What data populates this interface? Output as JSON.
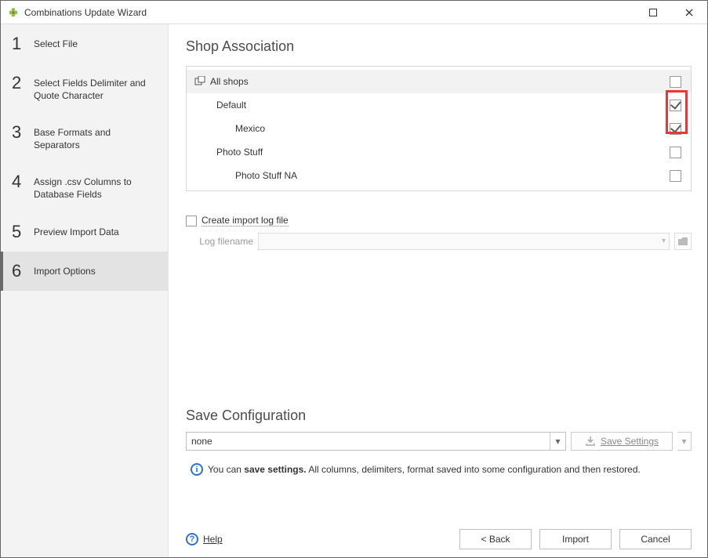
{
  "window": {
    "title": "Combinations Update Wizard"
  },
  "steps": [
    {
      "num": "1",
      "label": "Select File"
    },
    {
      "num": "2",
      "label": "Select Fields Delimiter and Quote Character"
    },
    {
      "num": "3",
      "label": "Base Formats and Separators"
    },
    {
      "num": "4",
      "label": "Assign .csv Columns to Database Fields"
    },
    {
      "num": "5",
      "label": "Preview Import Data"
    },
    {
      "num": "6",
      "label": "Import Options"
    }
  ],
  "active_step_index": 5,
  "shop_section": {
    "heading": "Shop Association",
    "rows": [
      {
        "label": "All shops",
        "indent": 0,
        "checked": false,
        "header": true
      },
      {
        "label": "Default",
        "indent": 1,
        "checked": true
      },
      {
        "label": "Mexico",
        "indent": 2,
        "checked": true
      },
      {
        "label": "Photo Stuff",
        "indent": 1,
        "checked": false
      },
      {
        "label": "Photo Stuff NA",
        "indent": 2,
        "checked": false
      }
    ]
  },
  "log": {
    "checkbox_label": "Create import log file",
    "checked": false,
    "filename_label": "Log filename",
    "filename_value": ""
  },
  "saveconf": {
    "heading": "Save Configuration",
    "selected": "none",
    "button_label": "Save Settings",
    "info_prefix": "You can ",
    "info_bold": "save settings.",
    "info_suffix": " All columns, delimiters, format saved into some configuration and then restored."
  },
  "footer": {
    "help": "Help",
    "back": "< Back",
    "import": "Import",
    "cancel": "Cancel"
  }
}
